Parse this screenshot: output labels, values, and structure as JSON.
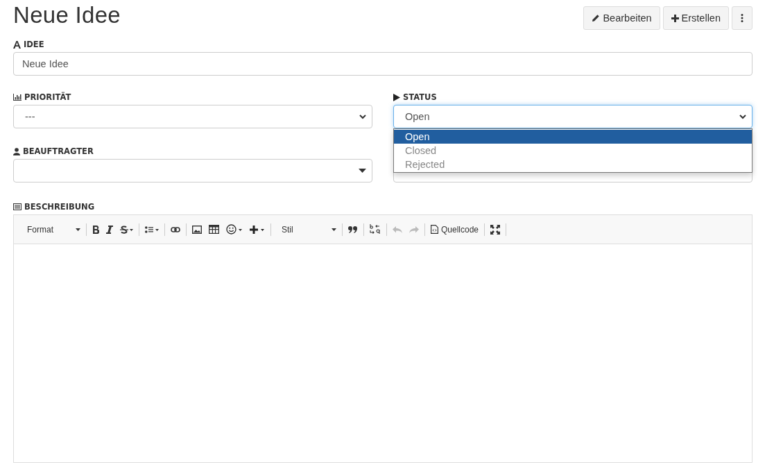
{
  "page_title": "Neue Idee",
  "actions": [
    {
      "label": "Bearbeiten"
    },
    {
      "label": "Erstellen"
    }
  ],
  "idea": {
    "label": "IDEE",
    "value": "Neue Idee"
  },
  "priority": {
    "label": "PRIORITÄT",
    "value": "---"
  },
  "status": {
    "label": "STATUS",
    "value": "Open",
    "expanded": true,
    "options": [
      {
        "label": "Open",
        "selected": true
      },
      {
        "label": "Closed",
        "selected": false
      },
      {
        "label": "Rejected",
        "selected": false
      }
    ]
  },
  "assignee": {
    "label": "BEAUFTRAGTER"
  },
  "description": {
    "label": "BESCHREIBUNG",
    "toolbar": {
      "format": "Format",
      "style": "Stil",
      "source": "Quellcode",
      "undo_disabled": true,
      "redo_disabled": true
    }
  }
}
